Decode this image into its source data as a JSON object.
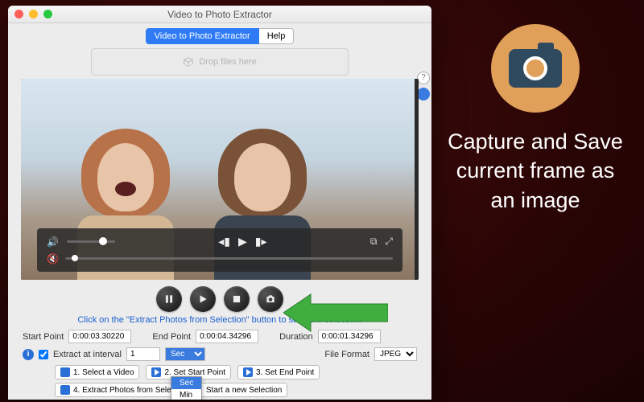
{
  "window": {
    "title": "Video to Photo Extractor"
  },
  "toolbar": {
    "main_tab": "Video to Photo Extractor",
    "help_tab": "Help"
  },
  "dropzone": {
    "label": "Drop files here"
  },
  "player": {
    "hint": "Click on the \"Extract Photos from Selection\" button to save the selection."
  },
  "fields": {
    "start_label": "Start Point",
    "start_value": "0:00:03.30220",
    "end_label": "End Point",
    "end_value": "0:00:04.34296",
    "duration_label": "Duration",
    "duration_value": "0:00:01.34296",
    "extract_interval_label": "Extract at interval",
    "extract_interval_value": "1",
    "unit_selected": "Sec",
    "unit_options": [
      "Sec",
      "Min"
    ],
    "file_format_label": "File Format",
    "file_format_value": "JPEG"
  },
  "steps": {
    "s1": "1. Select a Video",
    "s2": "2. Set Start Point",
    "s3": "3. Set End Point",
    "s4": "4. Extract Photos from Selection",
    "s5": "Start a new Selection"
  },
  "side": {
    "help": "?"
  },
  "promo": {
    "text": "Capture and Save current frame as an image"
  }
}
